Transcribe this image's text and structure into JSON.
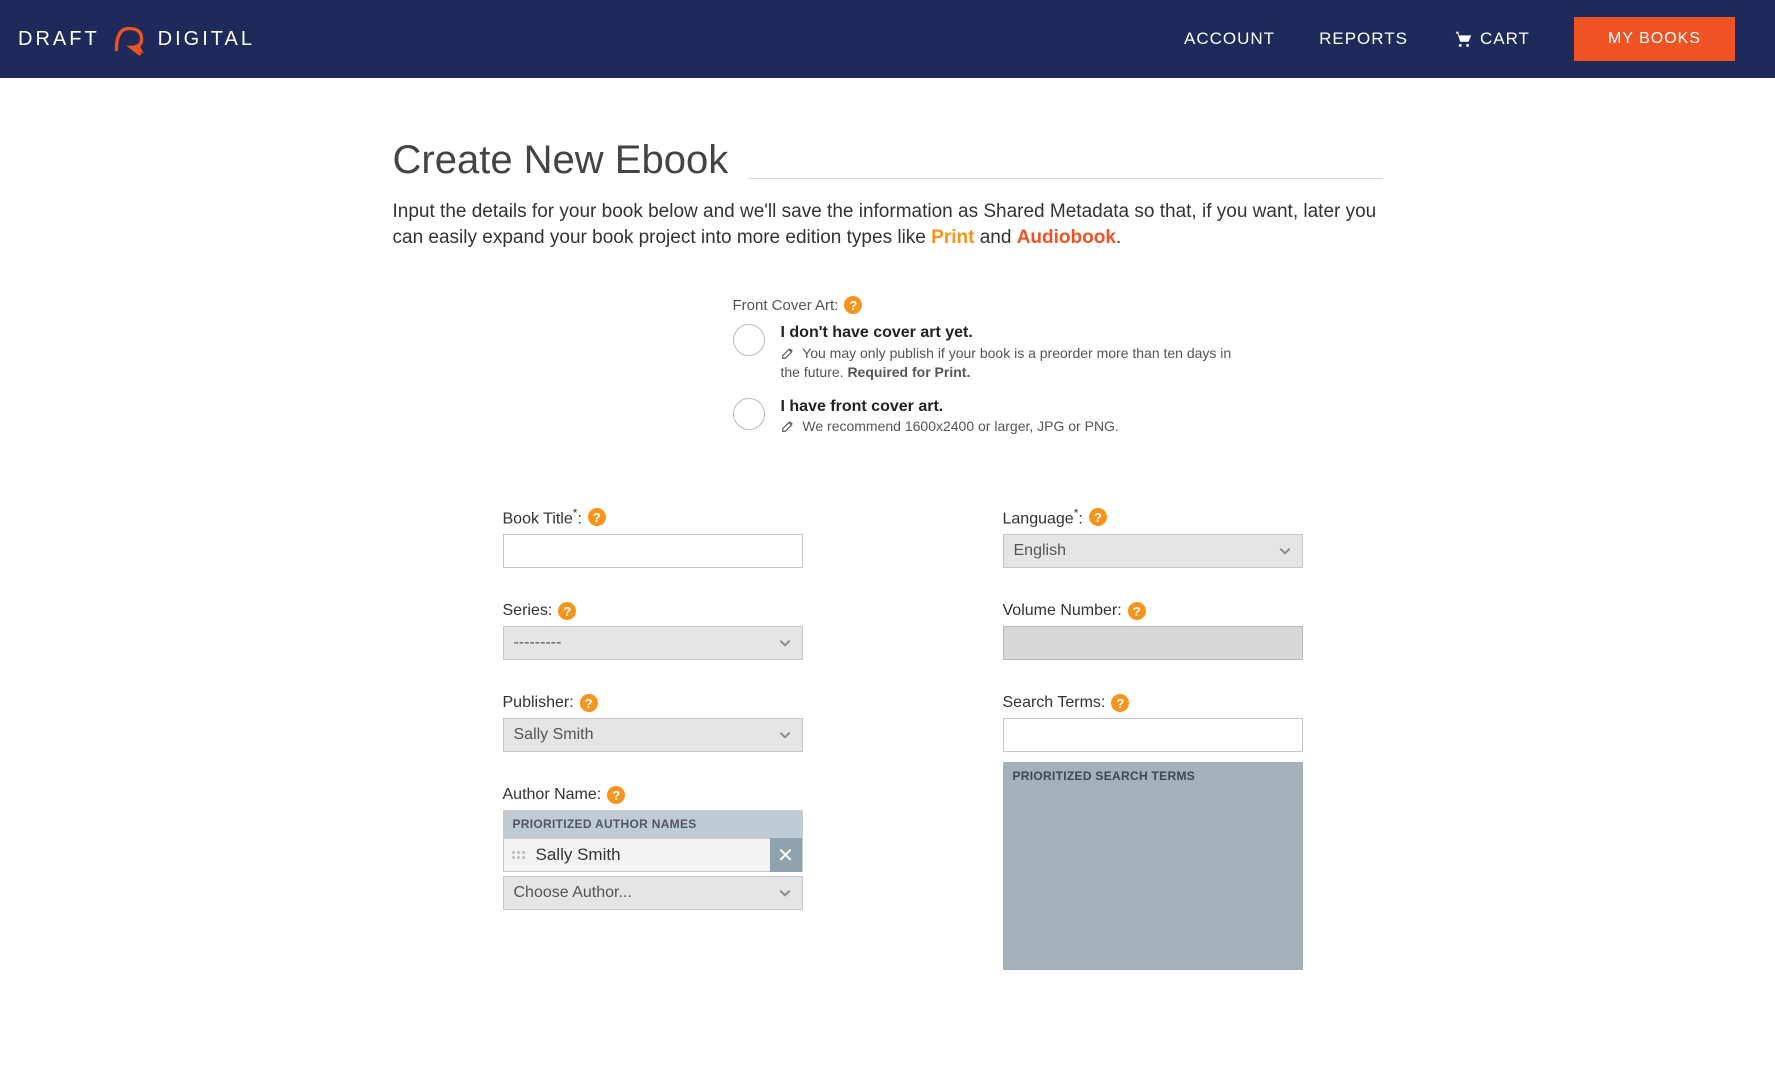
{
  "header": {
    "logo_left": "DRAFT",
    "logo_right": "DIGITAL",
    "nav": {
      "account": "ACCOUNT",
      "reports": "REPORTS",
      "cart": "CART",
      "my_books": "MY BOOKS"
    }
  },
  "page": {
    "title": "Create New Ebook",
    "intro_lead": "Input the details for your book below and we'll save the information as Shared Metadata so that, if you want, later you can easily expand your book project into more edition types like ",
    "intro_print": "Print",
    "intro_and": " and ",
    "intro_audio": "Audiobook",
    "intro_period": "."
  },
  "cover": {
    "label": "Front Cover Art:",
    "opt1_title": "I don't have cover art yet.",
    "opt1_note_a": "You may only publish if your book is a preorder more than ten days in the future. ",
    "opt1_note_b": "Required for Print.",
    "opt2_title": "I have front cover art.",
    "opt2_note": "We recommend 1600x2400 or larger, JPG or PNG."
  },
  "form": {
    "book_title_label": "Book Title",
    "series_label": "Series:",
    "series_value": "---------",
    "publisher_label": "Publisher:",
    "publisher_value": "Sally Smith",
    "author_label": "Author Name:",
    "author_panel_head": "PRIORITIZED AUTHOR NAMES",
    "author_chip": "Sally Smith",
    "choose_author": "Choose Author...",
    "language_label": "Language",
    "language_value": "English",
    "volume_label": "Volume Number:",
    "search_label": "Search Terms:",
    "search_panel_head": "PRIORITIZED SEARCH TERMS"
  }
}
